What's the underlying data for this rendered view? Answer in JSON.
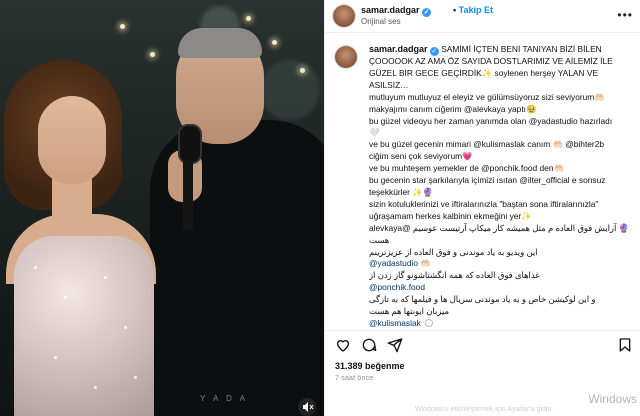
{
  "post": {
    "username": "samar.dadgar",
    "follow_label": "Takip Et",
    "audio_label": "Orijinal ses",
    "more_label": "•••"
  },
  "media": {
    "watermark": "Y A D A"
  },
  "caption": {
    "lines": [
      {
        "text": "SAMİMİ İÇTEN BENİ TANIYAN BİZİ BİLEN",
        "rtl": false
      },
      {
        "text": "ÇOOOOOK AZ AMA ÖZ SAYIDA DOSTLARIMIZ VE AİLEMİZ İLE",
        "rtl": false
      },
      {
        "text": "GÜZEL BİR GECE GEÇİRDİK✨ soylenen herşey YALAN VE",
        "rtl": false
      },
      {
        "text": "ASILSIZ…",
        "rtl": false
      },
      {
        "text": "mutluyum mutluyuz el eleyiz ve gülümsüyoruz sizi seviyorum🤲🏻",
        "rtl": false
      },
      {
        "text": "makyajımı canım ciğerim @alevkaya yaptı🥹",
        "rtl": false
      },
      {
        "text": "bu güzel videoyu her zaman yanımda olan @yadastudio hazırladı",
        "rtl": false
      },
      {
        "text": "🤍",
        "rtl": false
      },
      {
        "text": "ve bu güzel gecenin mimari @kulismaslak canım 🤲🏻 @bihter2b",
        "rtl": false
      },
      {
        "text": "ciğim seni çok seviyorum💗",
        "rtl": false
      },
      {
        "text": "ve bu muhteşem yemekler de @ponchik.food den🤲🏻",
        "rtl": false
      },
      {
        "text": "bu gecenin star şarkılarıyla içimizi ısıtan @ilter_official e sonsuz",
        "rtl": false
      },
      {
        "text": "teşekkürler ✨🔮",
        "rtl": false
      },
      {
        "text": "sizin kotuluklerinizi ve iftiralarınızla \"baştan sona iftiralarınızla\"",
        "rtl": false
      },
      {
        "text": "uğraşamam herkes kalbinin ekmeğini yer✨",
        "rtl": false
      },
      {
        "text": "🔮 آرایش فوق العاده م مثل همیشه کار میکاپ آرتیست عوسیم @alevkaya",
        "rtl": true
      },
      {
        "text": "هست",
        "rtl": true
      },
      {
        "text": "این ویدیو به یاد موندنی و فوق العاده از عزیزترینم",
        "rtl": true
      },
      {
        "text": "@yadastudio 🤲🏻",
        "rtl": false
      },
      {
        "text": "غذاهای فوق العاده که همه انگشتاشونو گاز زدن از",
        "rtl": true
      },
      {
        "text": "@ponchik.food",
        "rtl": false
      },
      {
        "text": "و این لوکیشن خاص و به یاد موندنی سریال ها و فیلمها که به تازگی",
        "rtl": true
      },
      {
        "text": "میزبان ایونتها هم هست",
        "rtl": true
      },
      {
        "text": "@kulismaslak",
        "rtl": false
      }
    ]
  },
  "footer": {
    "likes": "31.389 beğenme",
    "time": "7 saat önce",
    "windows_mark": "Windows",
    "windows_sub": "Windows'u etkinleştirmek için Ayarlar'a gidin."
  },
  "icons": {
    "like": "heart-icon",
    "comment": "comment-icon",
    "share": "send-icon",
    "save": "bookmark-icon"
  }
}
